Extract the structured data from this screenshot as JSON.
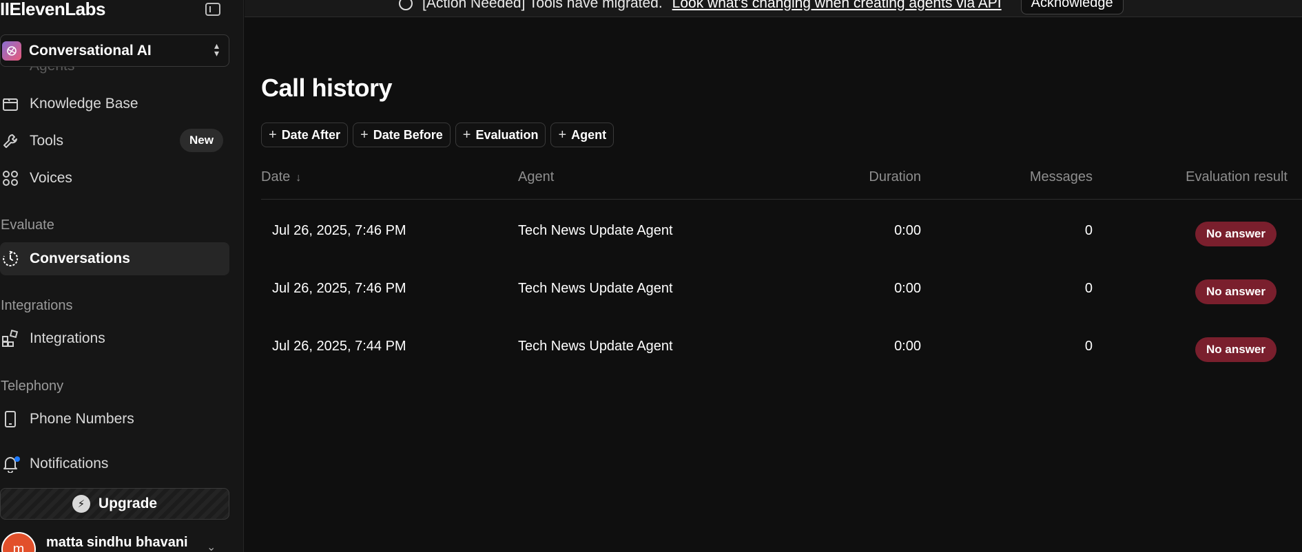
{
  "app": {
    "logo": "IIElevenLabs"
  },
  "sidebar": {
    "workspace": {
      "label": "Conversational AI"
    },
    "ghost_item": "Agents",
    "items": [
      {
        "label": "Knowledge Base",
        "icon": "folder-icon"
      },
      {
        "label": "Tools",
        "icon": "wrench-icon",
        "badge": "New"
      },
      {
        "label": "Voices",
        "icon": "voices-icon"
      }
    ],
    "sections": {
      "evaluate": "Evaluate",
      "integrations": "Integrations",
      "telephony": "Telephony"
    },
    "conversations": "Conversations",
    "integrations_item": "Integrations",
    "phone_numbers": "Phone Numbers",
    "notifications": "Notifications",
    "upgrade": "Upgrade",
    "user": {
      "initial": "m",
      "name": "matta sindhu bhavani"
    }
  },
  "banner": {
    "text": "[Action Needed] Tools have migrated.",
    "link": "Look what's changing when creating agents via API",
    "button": "Acknowledge"
  },
  "page": {
    "title": "Call history"
  },
  "filters": [
    "Date After",
    "Date Before",
    "Evaluation",
    "Agent"
  ],
  "table": {
    "headers": {
      "date": "Date",
      "agent": "Agent",
      "duration": "Duration",
      "messages": "Messages",
      "evaluation": "Evaluation result"
    },
    "rows": [
      {
        "date": "Jul 26, 2025, 7:46 PM",
        "agent": "Tech News Update Agent",
        "duration": "0:00",
        "messages": "0",
        "evaluation": "No answer"
      },
      {
        "date": "Jul 26, 2025, 7:46 PM",
        "agent": "Tech News Update Agent",
        "duration": "0:00",
        "messages": "0",
        "evaluation": "No answer"
      },
      {
        "date": "Jul 26, 2025, 7:44 PM",
        "agent": "Tech News Update Agent",
        "duration": "0:00",
        "messages": "0",
        "evaluation": "No answer"
      }
    ]
  },
  "colors": {
    "background": "#0f0f0f",
    "sidebar": "#161616",
    "status_no_answer": "#7a1f2d",
    "notification_dot": "#1e7bff",
    "avatar": "#e2502b"
  }
}
